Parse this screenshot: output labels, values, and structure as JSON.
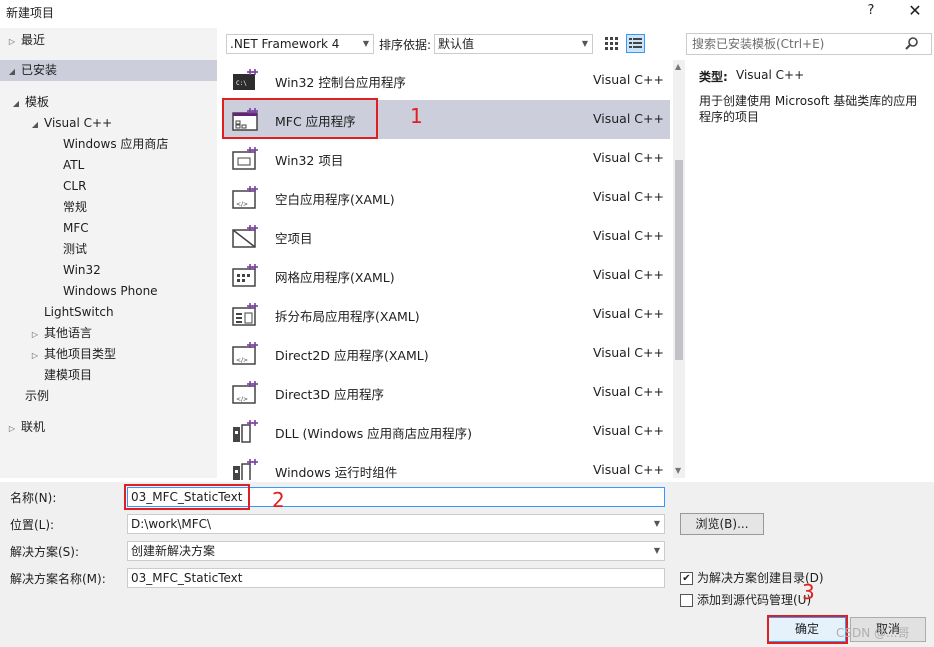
{
  "window": {
    "title": "新建项目",
    "help": "?",
    "close": "✕"
  },
  "tree": [
    {
      "label": "最近",
      "arrow": "▷",
      "indent": 0
    },
    {
      "label": "已安装",
      "arrow": "◢",
      "indent": 0,
      "selected": true
    },
    {
      "label": "模板",
      "arrow": "◢",
      "indent": 1
    },
    {
      "label": "Visual C++",
      "arrow": "◢",
      "indent": 2
    },
    {
      "label": "Windows 应用商店",
      "arrow": "",
      "indent": 3
    },
    {
      "label": "ATL",
      "arrow": "",
      "indent": 3
    },
    {
      "label": "CLR",
      "arrow": "",
      "indent": 3
    },
    {
      "label": "常规",
      "arrow": "",
      "indent": 3
    },
    {
      "label": "MFC",
      "arrow": "",
      "indent": 3
    },
    {
      "label": "测试",
      "arrow": "",
      "indent": 3
    },
    {
      "label": "Win32",
      "arrow": "",
      "indent": 3
    },
    {
      "label": "Windows Phone",
      "arrow": "",
      "indent": 3
    },
    {
      "label": "LightSwitch",
      "arrow": "",
      "indent": 2
    },
    {
      "label": "其他语言",
      "arrow": "▷",
      "indent": 2
    },
    {
      "label": "其他项目类型",
      "arrow": "▷",
      "indent": 2
    },
    {
      "label": "建模项目",
      "arrow": "",
      "indent": 2
    },
    {
      "label": "示例",
      "arrow": "",
      "indent": 1
    },
    {
      "label": "联机",
      "arrow": "▷",
      "indent": 0
    }
  ],
  "toolbar": {
    "framework": ".NET Framework 4",
    "sort_label": "排序依据:",
    "sort_value": "默认值"
  },
  "search": {
    "placeholder": "搜索已安装模板(Ctrl+E)",
    "icon": "search-icon"
  },
  "templates": [
    {
      "name": "Win32 控制台应用程序",
      "lang": "Visual C++",
      "icon": "console-app-icon"
    },
    {
      "name": "MFC 应用程序",
      "lang": "Visual C++",
      "icon": "mfc-app-icon",
      "selected": true
    },
    {
      "name": "Win32 项目",
      "lang": "Visual C++",
      "icon": "win32-project-icon"
    },
    {
      "name": "空白应用程序(XAML)",
      "lang": "Visual C++",
      "icon": "blank-app-icon"
    },
    {
      "name": "空项目",
      "lang": "Visual C++",
      "icon": "empty-project-icon"
    },
    {
      "name": "网格应用程序(XAML)",
      "lang": "Visual C++",
      "icon": "grid-app-icon"
    },
    {
      "name": "拆分布局应用程序(XAML)",
      "lang": "Visual C++",
      "icon": "split-app-icon"
    },
    {
      "name": "Direct2D 应用程序(XAML)",
      "lang": "Visual C++",
      "icon": "direct2d-app-icon"
    },
    {
      "name": "Direct3D 应用程序",
      "lang": "Visual C++",
      "icon": "direct3d-app-icon"
    },
    {
      "name": "DLL (Windows 应用商店应用程序)",
      "lang": "Visual C++",
      "icon": "dll-icon"
    },
    {
      "name": "Windows 运行时组件",
      "lang": "Visual C++",
      "icon": "runtime-component-icon"
    }
  ],
  "description": {
    "type_label": "类型:",
    "type_value": "Visual C++",
    "text": "用于创建使用 Microsoft 基础类库的应用程序的项目"
  },
  "form": {
    "name_label": "名称(N):",
    "name_value": "03_MFC_StaticText",
    "location_label": "位置(L):",
    "location_value": "D:\\work\\MFC\\",
    "solution_label": "解决方案(S):",
    "solution_value": "创建新解决方案",
    "solution_name_label": "解决方案名称(M):",
    "solution_name_value": "03_MFC_StaticText",
    "browse_label": "浏览(B)...",
    "create_dir_label": "为解决方案创建目录(D)",
    "create_dir_checked": true,
    "source_control_label": "添加到源代码管理(U)",
    "source_control_checked": false,
    "ok_label": "确定",
    "cancel_label": "取消"
  },
  "annotations": {
    "n1": "1",
    "n2": "2",
    "n3": "3",
    "color": "#e02020"
  },
  "watermark": "CSDN @...哥"
}
